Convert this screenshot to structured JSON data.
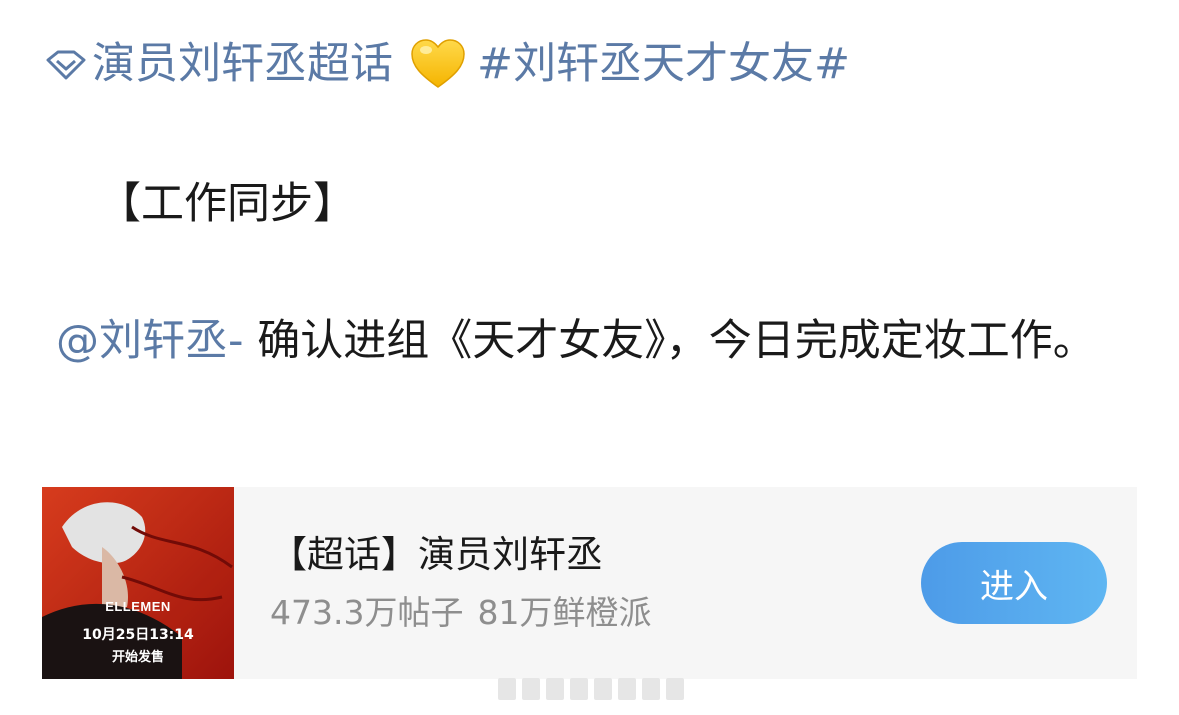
{
  "post": {
    "topic_name": "演员刘轩丞超话",
    "hashtag": "#刘轩丞天才女友#",
    "section_title": "【工作同步】",
    "mention": "@刘轩丞-",
    "body": " 确认进组《天才女友》，今日完成定妆工作。",
    "icons": {
      "topic": "diamond-icon",
      "emoji": "yellow-heart-icon"
    }
  },
  "card": {
    "title": "【超话】演员刘轩丞",
    "stats": {
      "posts": "473.3万帖子",
      "fans": "81万鲜橙派"
    },
    "button_label": "进入",
    "thumbnail": {
      "brand": "ELLEMEN",
      "date": "10月25日13:14",
      "caption": "开始发售"
    }
  },
  "colors": {
    "link": "#5b7aa6",
    "button_start": "#4d9be8",
    "button_end": "#5fb6f2",
    "card_bg": "#f6f6f6",
    "thumb_red": "#d32417"
  }
}
